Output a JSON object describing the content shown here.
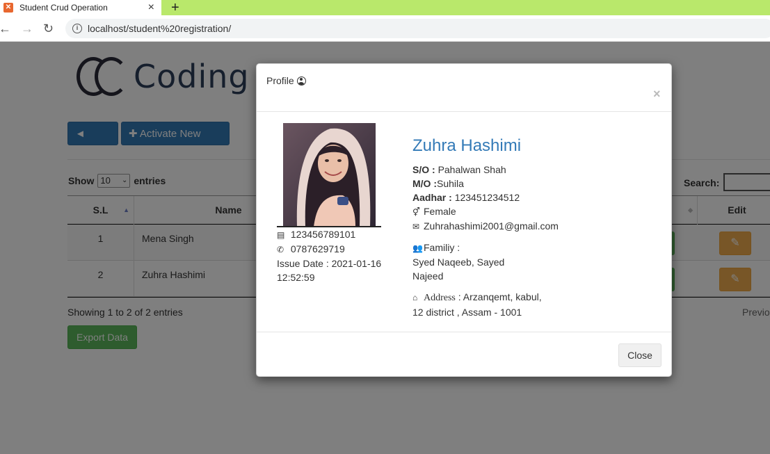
{
  "browser": {
    "tab_title": "Student Crud Operation",
    "tab_close": "×",
    "new_tab": "+",
    "url": "localhost/student%20registration/"
  },
  "page": {
    "logo_text": "Coding Cu",
    "back_label": "Back",
    "activate_label": "Activate New Card",
    "show_label": "Show",
    "entries_label": "entries",
    "page_size": "10",
    "search_label": "Search:",
    "columns": [
      "S.L",
      "Name",
      "Edit"
    ],
    "rows": [
      {
        "sl": "1",
        "name": "Mena Singh"
      },
      {
        "sl": "2",
        "name": "Zuhra Hashimi"
      }
    ],
    "info_text": "Showing 1 to 2 of 2 entries",
    "previous_label": "Previo",
    "export_label": "Export Data"
  },
  "modal": {
    "title": "Profile",
    "close_x": "×",
    "card_number": "123456789101",
    "phone": "0787629719",
    "issue_date": "Issue Date : 2021-01-16 12:52:59",
    "name": "Zuhra Hashimi",
    "so_label": "S/O :",
    "so_value": "Pahalwan Shah",
    "mo_label": "M/O :",
    "mo_value": "Suhila",
    "aadhar_label": "Aadhar :",
    "aadhar_value": "123451234512",
    "gender": "Female",
    "email": "Zuhrahashimi2001@gmail.com",
    "family_label": "Familiy :",
    "family_value": "Syed Naqeeb, Sayed Najeed",
    "address_label": "Address",
    "address_value": ": Arzanqemt, kabul, 12 district , Assam - 1001",
    "close_label": "Close"
  },
  "colors": {
    "primary": "#337ab7",
    "warning": "#f0ad4e",
    "success": "#5cb85c",
    "tab_strip": "#b9e86b"
  }
}
